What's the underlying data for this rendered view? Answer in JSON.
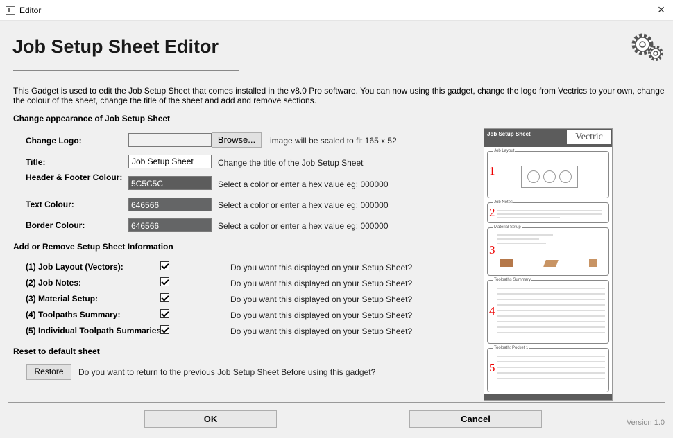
{
  "window": {
    "title": "Editor",
    "close_label": "×"
  },
  "header": {
    "title": "Job Setup Sheet Editor"
  },
  "intro": "This Gadget is used to edit the Job Setup Sheet that comes installed in the v8.0 Pro software. You can now using this gadget, change the logo from Vectrics to your own, change the colour of the sheet, change the title of the sheet and add and remove sections.",
  "appearance": {
    "section_title": "Change appearance of Job Setup Sheet",
    "logo": {
      "label": "Change Logo:",
      "value": "",
      "browse_label": "Browse...",
      "hint": "image will be scaled to fit 165 x 52"
    },
    "title": {
      "label": "Title:",
      "value": "Job Setup Sheet",
      "hint": "Change the title of the Job Setup Sheet"
    },
    "header_color": {
      "label": "Header & Footer Colour:",
      "value": "5C5C5C",
      "color": "#5c5c5c",
      "hint": "Select a color or enter a hex value eg: 000000"
    },
    "text_color": {
      "label": "Text Colour:",
      "value": "646566",
      "color": "#646566",
      "hint": "Select a color or enter a hex value eg: 000000"
    },
    "border_color": {
      "label": "Border Colour:",
      "value": "646566",
      "color": "#646566",
      "hint": "Select a color or enter a hex value eg: 000000"
    }
  },
  "sections": {
    "section_title": "Add or Remove Setup Sheet Information",
    "items": [
      {
        "label": "(1) Job Layout (Vectors):",
        "checked": true,
        "question": "Do you want this displayed on your Setup Sheet?"
      },
      {
        "label": "(2) Job Notes:",
        "checked": true,
        "question": "Do you want this displayed on your Setup Sheet?"
      },
      {
        "label": "(3) Material Setup:",
        "checked": true,
        "question": "Do you want this displayed on your Setup Sheet?"
      },
      {
        "label": "(4) Toolpaths Summary:",
        "checked": true,
        "question": "Do you want this displayed on your Setup Sheet?"
      },
      {
        "label": "(5) Individual Toolpath Summaries:",
        "checked": true,
        "question": "Do you want this displayed on your Setup Sheet?"
      }
    ]
  },
  "reset": {
    "section_title": "Reset to default sheet",
    "restore_label": "Restore",
    "question": "Do you want to return to the previous Job Setup Sheet Before using this gadget?"
  },
  "preview": {
    "title": "Job Setup Sheet",
    "logo_text": "Vectric",
    "boxes": [
      {
        "label": "Job Layout",
        "number": "1"
      },
      {
        "label": "Job Notes",
        "number": "2"
      },
      {
        "label": "Material Setup",
        "number": "3"
      },
      {
        "label": "Toolpaths Summary",
        "number": "4"
      },
      {
        "label": "Toolpath: Pocket 1",
        "number": "5"
      }
    ]
  },
  "footer": {
    "ok_label": "OK",
    "cancel_label": "Cancel",
    "version": "Version 1.0"
  }
}
